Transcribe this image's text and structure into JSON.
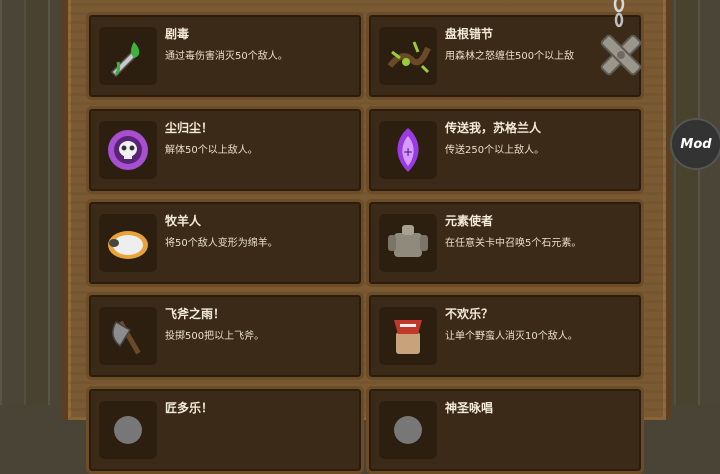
{
  "mod_button": {
    "label": "Mod"
  },
  "close_button": {
    "icon": "close-x-icon"
  },
  "achievements": [
    {
      "title": "剧毒",
      "desc": "通过毒伤害消灭50个敌人。",
      "icon": "poison-dagger-icon",
      "color": "#3fb23b"
    },
    {
      "title": "盘根错节",
      "desc": "用森林之怒缠住500个以上敌",
      "icon": "thorny-roots-icon",
      "color": "#9acb3a"
    },
    {
      "title": "尘归尘！",
      "desc": "解体50个以上敌人。",
      "icon": "skull-rune-icon",
      "color": "#a64fd0"
    },
    {
      "title": "传送我，苏格兰人",
      "desc": "传送250个以上敌人。",
      "icon": "teleport-icon",
      "color": "#9a3be0"
    },
    {
      "title": "牧羊人",
      "desc": "将50个敌人变形为绵羊。",
      "icon": "sheep-icon",
      "color": "#e8a23a"
    },
    {
      "title": "元素使者",
      "desc": "在任意关卡中召唤5个石元素。",
      "icon": "stone-golem-icon",
      "color": "#8f8a7c"
    },
    {
      "title": "飞斧之雨！",
      "desc": "投掷500把以上飞斧。",
      "icon": "axe-icon",
      "color": "#8c8c8c"
    },
    {
      "title": "不欢乐？",
      "desc": "让单个野蛮人消灭10个敌人。",
      "icon": "barbarian-icon",
      "color": "#c0392b"
    },
    {
      "title": "匠多乐！",
      "desc": "",
      "icon": "placeholder-icon",
      "color": "#777"
    },
    {
      "title": "神圣咏唱",
      "desc": "",
      "icon": "placeholder-icon",
      "color": "#777"
    }
  ]
}
